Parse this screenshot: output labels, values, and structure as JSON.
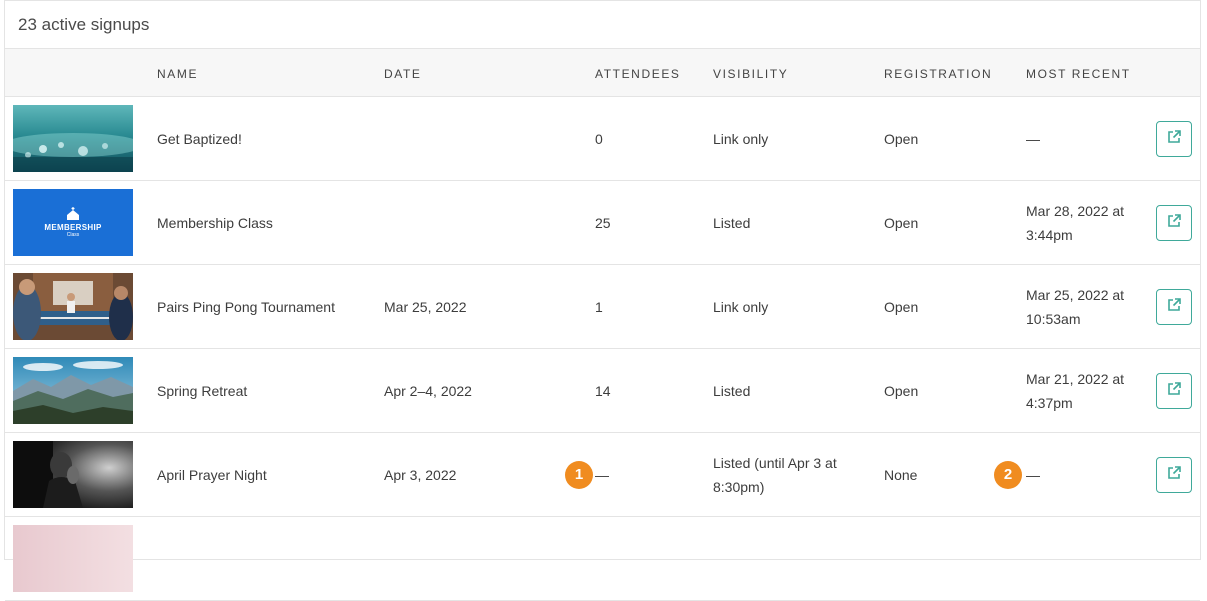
{
  "panel": {
    "title": "23 active signups"
  },
  "columns": {
    "name": "NAME",
    "date": "DATE",
    "attendees": "ATTENDEES",
    "visibility": "VISIBILITY",
    "registration": "REGISTRATION",
    "most_recent": "MOST RECENT"
  },
  "rows": [
    {
      "name": "Get Baptized!",
      "date": "",
      "attendees": "0",
      "visibility": "Link only",
      "registration": "Open",
      "most_recent": "—"
    },
    {
      "name": "Membership Class",
      "date": "",
      "attendees": "25",
      "visibility": "Listed",
      "registration": "Open",
      "most_recent": "Mar 28, 2022 at 3:44pm",
      "thumb_text": "MEMBERSHIP",
      "thumb_subtext": "Class"
    },
    {
      "name": "Pairs Ping Pong Tournament",
      "date": "Mar 25, 2022",
      "attendees": "1",
      "visibility": "Link only",
      "registration": "Open",
      "most_recent": "Mar 25, 2022 at 10:53am"
    },
    {
      "name": "Spring Retreat",
      "date": "Apr 2–4, 2022",
      "attendees": "14",
      "visibility": "Listed",
      "registration": "Open",
      "most_recent": "Mar 21, 2022 at 4:37pm"
    },
    {
      "name": "April Prayer Night",
      "date": "Apr 3, 2022",
      "attendees": "—",
      "visibility": "Listed (until Apr 3 at 8:30pm)",
      "registration": "None",
      "most_recent": "—"
    }
  ],
  "badges": {
    "first": "1",
    "second": "2"
  },
  "colors": {
    "accent": "#3fa99a",
    "badge": "#f08c20",
    "membership_blue": "#1a6fd6"
  },
  "icons": {
    "open_link": "external-link-icon"
  }
}
